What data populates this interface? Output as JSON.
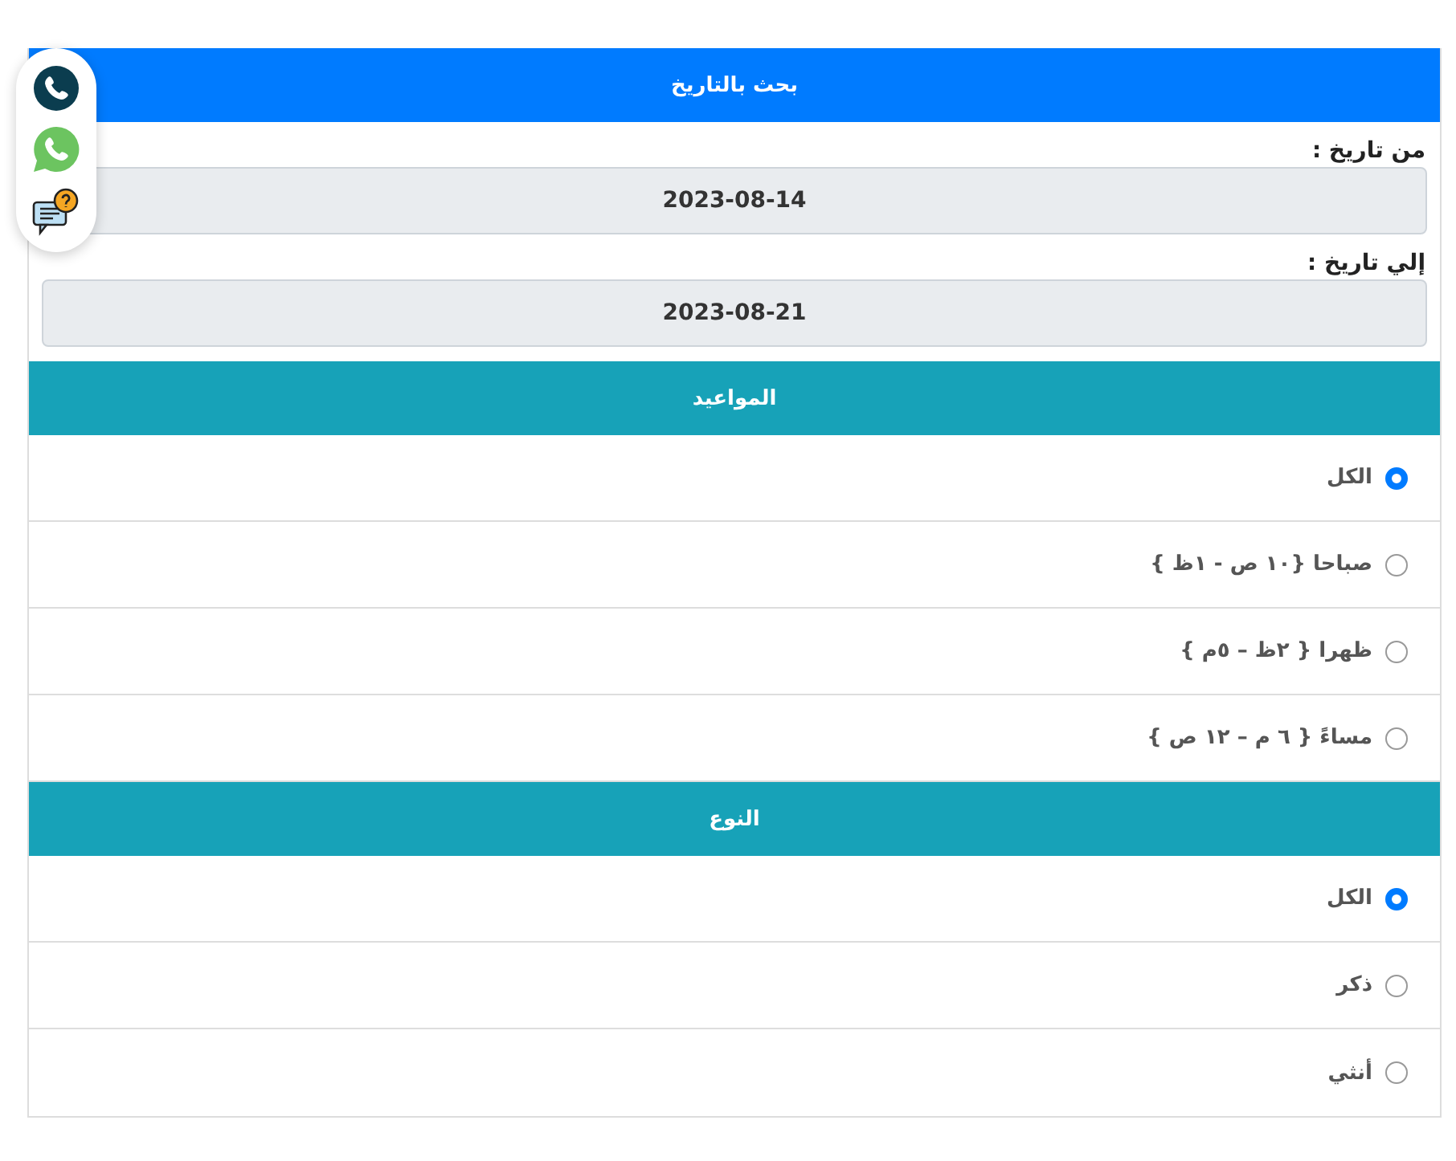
{
  "date_search": {
    "title": "بحث بالتاريخ",
    "from_label": "من تاريخ :",
    "from_value": "2023-08-14",
    "to_label": "إلي تاريخ :",
    "to_value": "2023-08-21"
  },
  "times": {
    "title": "المواعيد",
    "options": [
      {
        "label": "الكل",
        "selected": true
      },
      {
        "label": "صباحا {١٠ ص - ١ظ }",
        "selected": false
      },
      {
        "label": "ظهرا { ٢ظ – ٥م }",
        "selected": false
      },
      {
        "label": "مساءً { ٦ م – ١٢ ص }",
        "selected": false
      }
    ]
  },
  "type": {
    "title": "النوع",
    "options": [
      {
        "label": "الكل",
        "selected": true
      },
      {
        "label": "ذكر",
        "selected": false
      },
      {
        "label": "أنثي",
        "selected": false
      }
    ]
  },
  "contact_buttons": [
    {
      "kind": "phone"
    },
    {
      "kind": "whatsapp"
    },
    {
      "kind": "chat"
    }
  ]
}
